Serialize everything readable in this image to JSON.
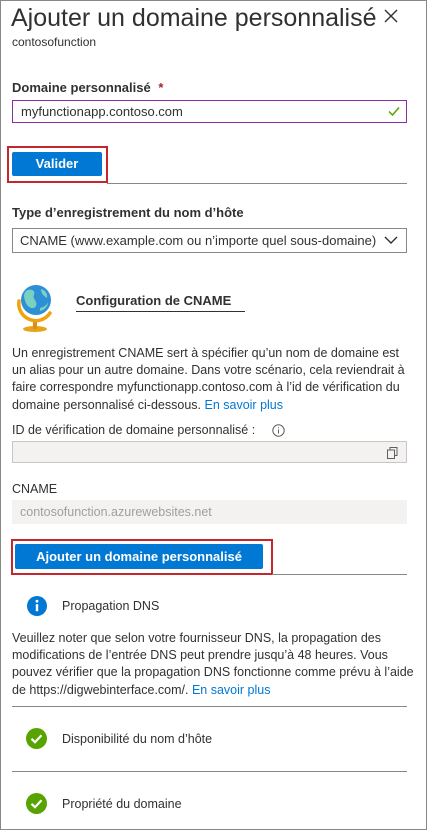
{
  "header": {
    "title": "Ajouter un domaine personnalisé",
    "subtitle": "contosofunction",
    "close_icon": "close-icon"
  },
  "custom_domain": {
    "label": "Domaine personnalisé",
    "required_mark": "*",
    "value": "myfunctionapp.contoso.com",
    "valid_icon": "checkmark-icon"
  },
  "validate_button": "Valider",
  "hostname_record": {
    "label": "Type d’enregistrement du nom d’hôte",
    "selected": "CNAME (www.example.com ou n’importe quel sous-domaine)"
  },
  "cname_config": {
    "icon": "globe-icon",
    "heading": "Configuration de CNAME",
    "description": "Un enregistrement CNAME sert à spécifier qu’un nom de domaine est un alias pour un autre domaine. Dans votre scénario, cela reviendrait à faire correspondre myfunctionapp.contoso.com à l’id de vérification du domaine personnalisé ci-dessous.",
    "learn_more": "En savoir plus",
    "verification_label": "ID de vérification de domaine personnalisé :",
    "verification_value": "",
    "cname_label": "CNAME",
    "cname_value": "contosofunction.azurewebsites.net"
  },
  "add_button": "Ajouter un domaine personnalisé",
  "dns": {
    "title": "Propagation DNS",
    "description": "Veuillez noter que selon votre fournisseur DNS, la propagation des modifications de l’entrée DNS peut prendre jusqu’à 48 heures. Vous pouvez vérifier que la propagation DNS fonctionne comme prévu à l’aide de https://digwebinterface.com/.",
    "learn_more": "En savoir plus"
  },
  "checks": [
    {
      "label": "Disponibilité du nom d’hôte",
      "status": "success"
    },
    {
      "label": "Propriété du domaine",
      "status": "success"
    }
  ],
  "colors": {
    "accent": "#0078d4",
    "highlight": "#c4262e",
    "success": "#57a300",
    "info": "#0078d4"
  }
}
